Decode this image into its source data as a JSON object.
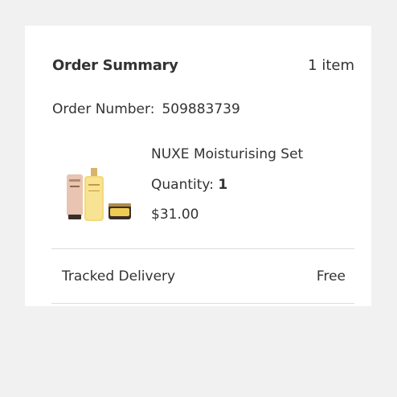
{
  "summary": {
    "title": "Order Summary",
    "item_count": "1 item",
    "order_number_label": "Order Number:",
    "order_number_value": "509883739"
  },
  "product": {
    "name": "NUXE Moisturising Set",
    "quantity_label": "Quantity:",
    "quantity_value": "1",
    "price": "$31.00",
    "image_icon": "product-image"
  },
  "delivery": {
    "label": "Tracked Delivery",
    "value": "Free"
  },
  "colors": {
    "page_background": "#f1f1f1",
    "card_background": "#ffffff",
    "text": "#333333",
    "divider": "#dcdcdc"
  }
}
